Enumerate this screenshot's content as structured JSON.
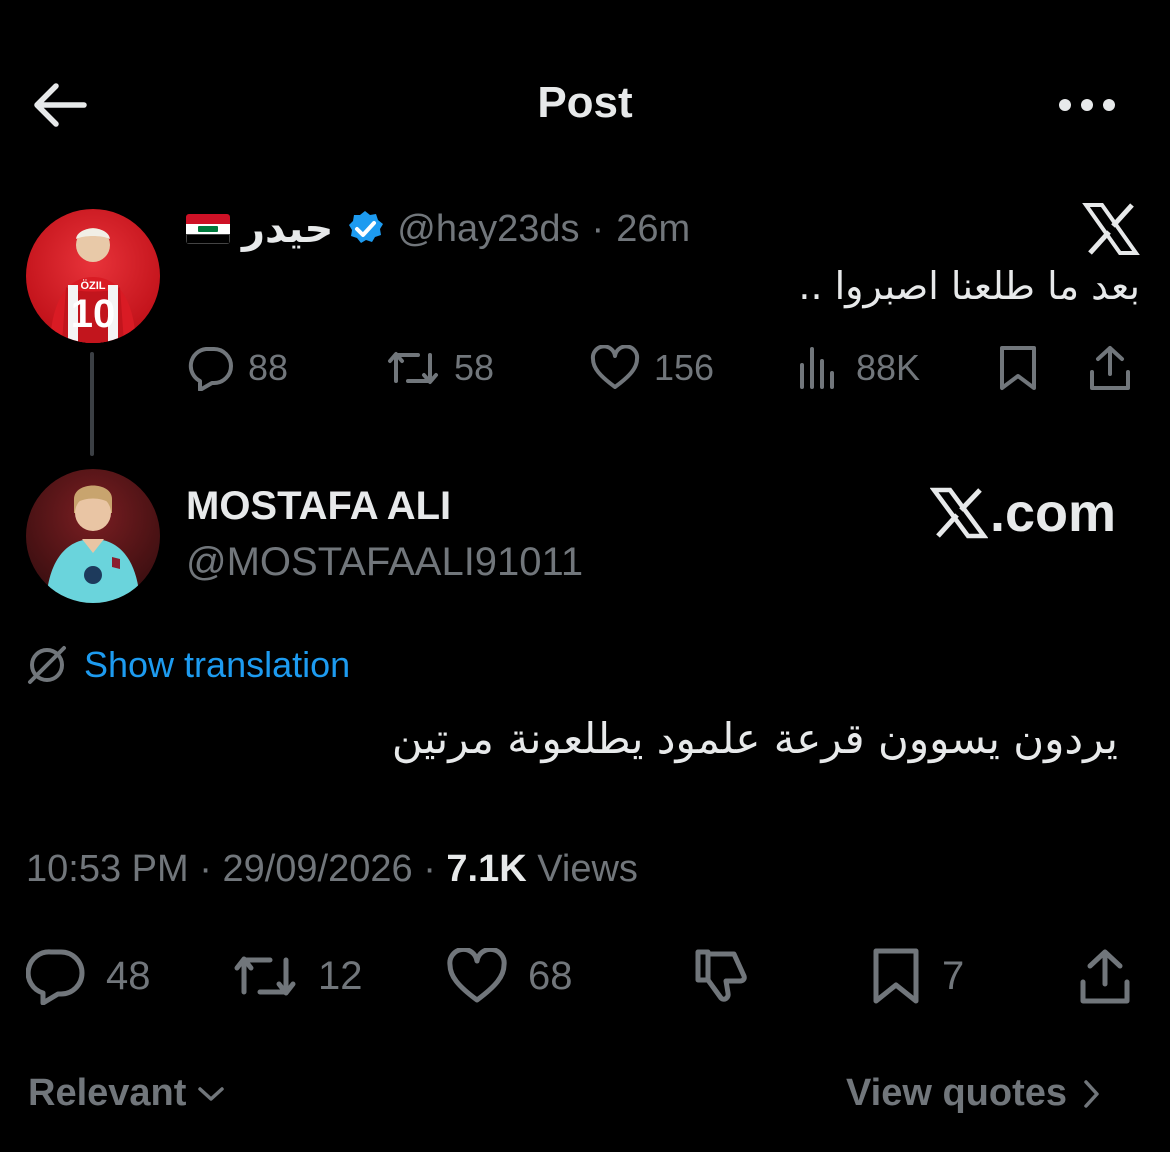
{
  "header": {
    "title": "Post"
  },
  "quoted_post": {
    "display_name": "حيدر",
    "handle": "@hay23ds",
    "separator": "·",
    "time_ago": "26m",
    "text": "بعد ما طلعنا اصبروا ..",
    "actions": {
      "replies": "88",
      "reposts": "58",
      "likes": "156",
      "views": "88K"
    }
  },
  "main_post": {
    "display_name": "MOSTAFA ALI",
    "handle": "@MOSTAFAALI91011",
    "watermark": ".com",
    "translate_label": "Show translation",
    "text": "يردون يسوون قرعة علمود يطلعونة مرتين",
    "time": "10:53 PM",
    "date": "29/09/2026",
    "separator": "·",
    "views_count": "7.1K",
    "views_label": "Views",
    "actions": {
      "replies": "48",
      "reposts": "12",
      "likes": "68",
      "bookmarks": "7"
    }
  },
  "footer": {
    "sort_label": "Relevant",
    "quotes_label": "View quotes"
  },
  "colors": {
    "background": "#000000",
    "text": "#e7e9ea",
    "secondary": "#71767b",
    "accent": "#1d9bf0",
    "verified": "#1d9bf0"
  },
  "icons": [
    "back-arrow-icon",
    "more-icon",
    "x-logo-icon",
    "verified-badge-icon",
    "reply-icon",
    "repost-icon",
    "like-icon",
    "views-icon",
    "bookmark-icon",
    "share-icon",
    "translate-icon",
    "dislike-icon",
    "chevron-down-icon",
    "chevron-right-icon"
  ]
}
